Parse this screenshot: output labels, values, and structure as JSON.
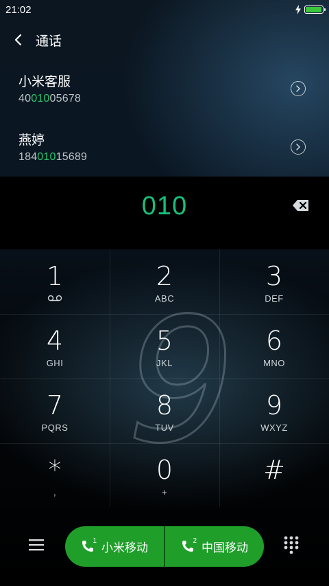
{
  "status_bar": {
    "time": "21:02",
    "battery_level": 0.95,
    "battery_color": "#3cc63c"
  },
  "header": {
    "title": "通话"
  },
  "results": [
    {
      "name": "小米客服",
      "number_prefix": "40",
      "number_match": "010",
      "number_suffix": "05678"
    },
    {
      "name": "燕婷",
      "number_prefix": "184",
      "number_match": "010",
      "number_suffix": "15689"
    }
  ],
  "dial_input": {
    "value": "010",
    "color": "#16c07b"
  },
  "watermark_digit": "9",
  "keypad": [
    {
      "digit": "1",
      "letters": ""
    },
    {
      "digit": "2",
      "letters": "ABC"
    },
    {
      "digit": "3",
      "letters": "DEF"
    },
    {
      "digit": "4",
      "letters": "GHI"
    },
    {
      "digit": "5",
      "letters": "JKL"
    },
    {
      "digit": "6",
      "letters": "MNO"
    },
    {
      "digit": "7",
      "letters": "PQRS"
    },
    {
      "digit": "8",
      "letters": "TUV"
    },
    {
      "digit": "9",
      "letters": "WXYZ"
    },
    {
      "digit": "*",
      "letters": ","
    },
    {
      "digit": "0",
      "letters": "+"
    },
    {
      "digit": "#",
      "letters": ""
    }
  ],
  "call_buttons": [
    {
      "label": "小米移动",
      "sim": "1"
    },
    {
      "label": "中国移动",
      "sim": "2"
    }
  ],
  "colors": {
    "call_green": "#1f9e2a",
    "highlight_green": "#28c76f"
  }
}
